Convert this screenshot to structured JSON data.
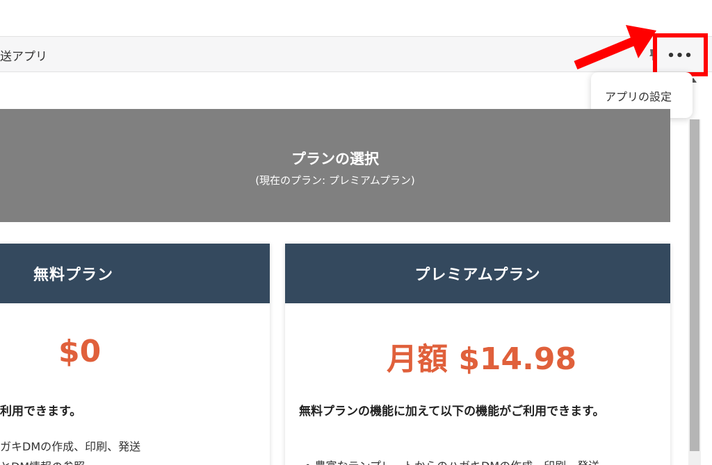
{
  "topbar": {
    "app_title": "送アプリ",
    "more_label": "•••"
  },
  "menu": {
    "items": [
      "アプリの設定"
    ]
  },
  "banner": {
    "title": "プランの選択",
    "subtitle": "(現在のプラン: プレミアムプラン)"
  },
  "plans": [
    {
      "name": "無料プラン",
      "price": "$0",
      "lead": "利用できます。",
      "features": [
        "ガキDMの作成、印刷、発送",
        "とDM情報の参照"
      ]
    },
    {
      "name": "プレミアムプラン",
      "price": "月額 $14.98",
      "lead": "無料プランの機能に加えて以下の機能がご利用できます。",
      "features": [
        "• 豊富なテンプレートからのハガキDMの作成、印刷、発送"
      ]
    }
  ],
  "colors": {
    "header_bg": "#34495e",
    "price": "#e0603b",
    "banner_bg": "#808080",
    "annotation": "#ff0000"
  },
  "icons": {
    "more": "ellipsis-icon",
    "pin": "pin-icon",
    "annotation": "red-arrow-icon"
  }
}
